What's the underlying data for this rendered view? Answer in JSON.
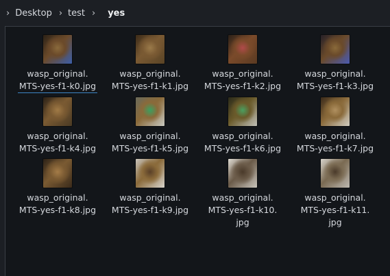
{
  "breadcrumb": {
    "items": [
      "Desktop",
      "test"
    ],
    "current": "yes"
  },
  "files": [
    {
      "name": "wasp_original.\nMTS-yes-f1-k0.jpg",
      "thumb": [
        "#2b2116",
        "#6b4a2a",
        "#8a6a3c",
        "#3c5ea8"
      ]
    },
    {
      "name": "wasp_original.\nMTS-yes-f1-k1.jpg",
      "thumb": [
        "#3a2a18",
        "#7a5a33",
        "#9a7a4a",
        "#5a4426"
      ]
    },
    {
      "name": "wasp_original.\nMTS-yes-f1-k2.jpg",
      "thumb": [
        "#2a2018",
        "#7a4a2a",
        "#b04a4a",
        "#5a3a22"
      ]
    },
    {
      "name": "wasp_original.\nMTS-yes-f1-k3.jpg",
      "thumb": [
        "#262028",
        "#6a4a2a",
        "#8a6a3a",
        "#4a5ab0"
      ]
    },
    {
      "name": "wasp_original.\nMTS-yes-f1-k4.jpg",
      "thumb": [
        "#2a2016",
        "#7a5a32",
        "#a07a46",
        "#4a3a24"
      ]
    },
    {
      "name": "wasp_original.\nMTS-yes-f1-k5.jpg",
      "thumb": [
        "#6a6a5a",
        "#8a6a3a",
        "#3aa060",
        "#c8c8c0"
      ]
    },
    {
      "name": "wasp_original.\nMTS-yes-f1-k6.jpg",
      "thumb": [
        "#2a2a1a",
        "#6a5a2a",
        "#4aa060",
        "#c0c0b8"
      ]
    },
    {
      "name": "wasp_original.\nMTS-yes-f1-k7.jpg",
      "thumb": [
        "#3a2a1a",
        "#8a6a3a",
        "#b09060",
        "#d0ccc0"
      ]
    },
    {
      "name": "wasp_original.\nMTS-yes-f1-k8.jpg",
      "thumb": [
        "#2a2016",
        "#7a5a32",
        "#a47c48",
        "#3a2a1a"
      ]
    },
    {
      "name": "wasp_original.\nMTS-yes-f1-k9.jpg",
      "thumb": [
        "#c8c4bc",
        "#8a6a3a",
        "#5a4028",
        "#d8d4cc"
      ]
    },
    {
      "name": "wasp_original.\nMTS-yes-f1-k10.\njpg",
      "thumb": [
        "#e0dcd4",
        "#6a5a48",
        "#4a3a2a",
        "#c8c4bc"
      ]
    },
    {
      "name": "wasp_original.\nMTS-yes-f1-k11.\njpg",
      "thumb": [
        "#d8d4cc",
        "#7a6a52",
        "#4a3a2a",
        "#bcb8b0"
      ]
    }
  ]
}
